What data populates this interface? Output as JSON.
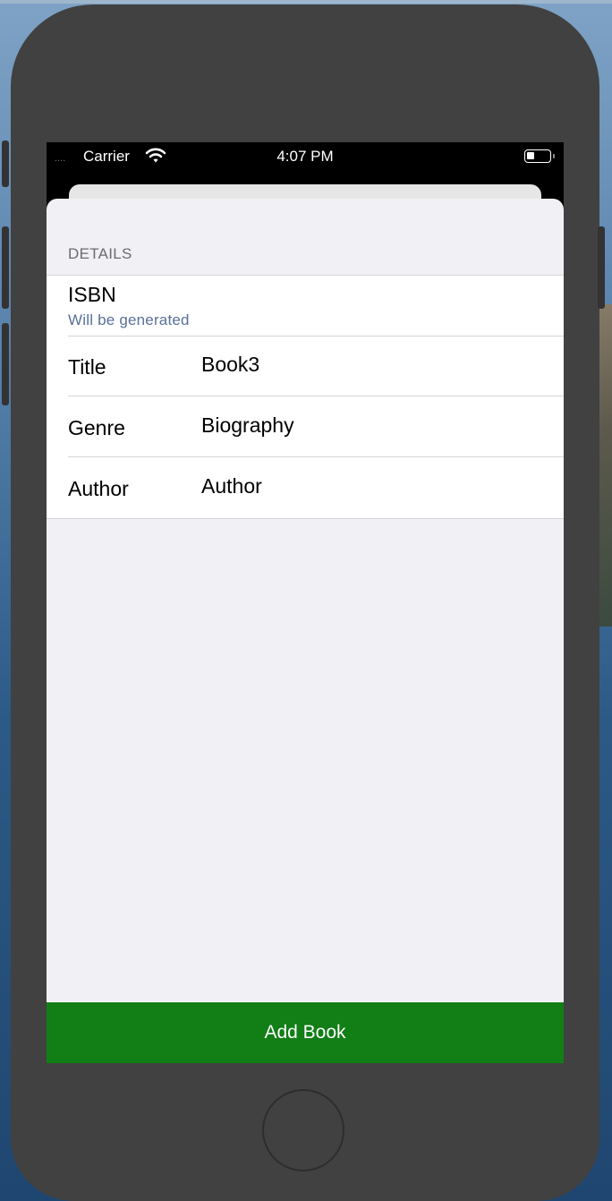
{
  "status_bar": {
    "carrier": "Carrier",
    "time": "4:07 PM",
    "signal_dots": "....",
    "wifi_icon": "wifi-icon",
    "battery_icon": "battery-icon"
  },
  "form": {
    "section_header": "DETAILS",
    "isbn": {
      "label": "ISBN",
      "detail": "Will be generated"
    },
    "fields": [
      {
        "label": "Title",
        "value": "Book3"
      },
      {
        "label": "Genre",
        "value": "Biography"
      },
      {
        "label": "Author",
        "value": "Author"
      }
    ]
  },
  "actions": {
    "add_label": "Add Book"
  },
  "colors": {
    "accent": "#117e16",
    "secondary_text": "#5a6f9a",
    "background": "#f1f1f5",
    "device_frame": "#414141"
  }
}
